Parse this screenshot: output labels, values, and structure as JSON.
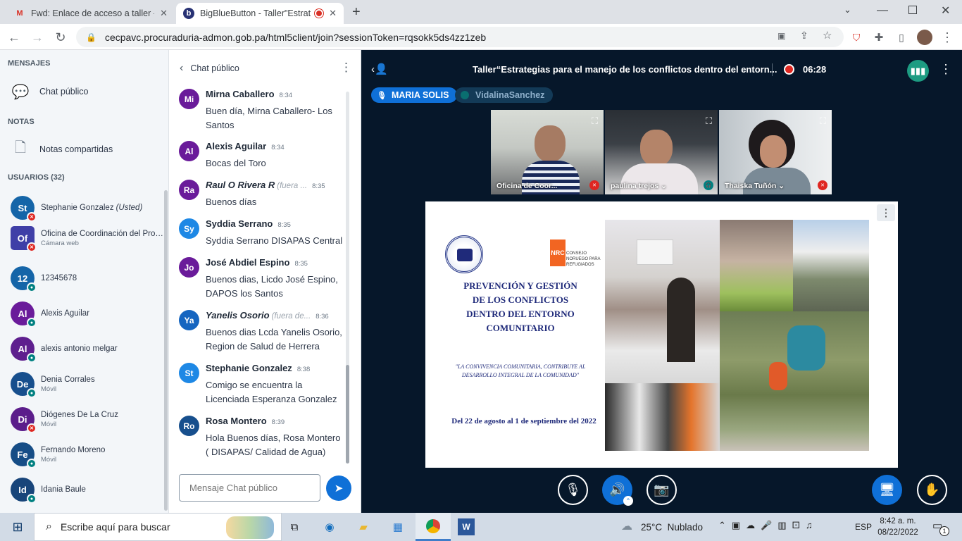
{
  "browser": {
    "tabs": [
      {
        "title": "Fwd: Enlace de acceso a taller - t",
        "active": false
      },
      {
        "title": "BigBlueButton - Taller\"Estrate",
        "active": true
      }
    ],
    "new_tab": "+",
    "url": "cecpavc.procuraduria-admon.gob.pa/html5client/join?sessionToken=rqsokk5ds4zz1zeb"
  },
  "sidebar": {
    "messages_title": "MENSAJES",
    "public_chat_label": "Chat público",
    "notes_title": "NOTAS",
    "shared_notes_label": "Notas compartidas",
    "users_title": "USUARIOS (32)",
    "users": [
      {
        "initials": "St",
        "name": "Stephanie Gonzalez",
        "you": "(Usted)",
        "sub": "",
        "color": "#1565a8",
        "badge": "red",
        "square": false
      },
      {
        "initials": "Of",
        "name": "Oficina de Coordinación del Progr...",
        "you": "",
        "sub": "Cámara web",
        "color": "#3f3fa7",
        "badge": "red",
        "square": true
      },
      {
        "initials": "12",
        "name": "12345678",
        "you": "",
        "sub": "",
        "color": "#1565a8",
        "badge": "teal",
        "square": false
      },
      {
        "initials": "Al",
        "name": "Alexis Aguilar",
        "you": "",
        "sub": "",
        "color": "#6a1b9a",
        "badge": "teal",
        "square": false
      },
      {
        "initials": "Al",
        "name": "alexis antonio melgar",
        "you": "",
        "sub": "",
        "color": "#5e1f8e",
        "badge": "teal",
        "square": false
      },
      {
        "initials": "De",
        "name": "Denia Corrales",
        "you": "",
        "sub": "Móvil",
        "color": "#174f8d",
        "badge": "teal",
        "square": false
      },
      {
        "initials": "Di",
        "name": "Diógenes De La Cruz",
        "you": "",
        "sub": "Móvil",
        "color": "#5b1d8b",
        "badge": "red",
        "square": false
      },
      {
        "initials": "Fe",
        "name": "Fernando Moreno",
        "you": "",
        "sub": "Móvil",
        "color": "#164d86",
        "badge": "teal",
        "square": false
      },
      {
        "initials": "Id",
        "name": "Idania Baule",
        "you": "",
        "sub": "",
        "color": "#18457a",
        "badge": "teal",
        "square": false
      }
    ]
  },
  "chat": {
    "title": "Chat público",
    "input_placeholder": "Mensaje Chat público",
    "messages": [
      {
        "initials": "Mi",
        "name": "Mirna Caballero",
        "note": "",
        "time": "8:34",
        "text": "Buen día, Mirna Caballero- Los Santos",
        "color": "#6a1b9a",
        "italic": false
      },
      {
        "initials": "Al",
        "name": "Alexis Aguilar",
        "note": "",
        "time": "8:34",
        "text": "Bocas del Toro",
        "color": "#6a1b9a",
        "italic": false
      },
      {
        "initials": "Ra",
        "name": "Raul O Rivera R",
        "note": "(fuera ...",
        "time": "8:35",
        "text": "Buenos días",
        "color": "#6a1b9a",
        "italic": true
      },
      {
        "initials": "Sy",
        "name": "Syddia Serrano",
        "note": "",
        "time": "8:35",
        "text": "Syddia Serrano DISAPAS Central",
        "color": "#1e88e5",
        "italic": false
      },
      {
        "initials": "Jo",
        "name": "José Abdiel Espino",
        "note": "",
        "time": "8:35",
        "text": "Buenos dias, Licdo José Espino, DAPOS los Santos",
        "color": "#6a1b9a",
        "italic": false
      },
      {
        "initials": "Ya",
        "name": "Yanelis Osorio",
        "note": "(fuera de...",
        "time": "8:36",
        "text": "Buenos dias Lcda Yanelis Osorio, Region de Salud de Herrera",
        "color": "#1565c0",
        "italic": true
      },
      {
        "initials": "St",
        "name": "Stephanie Gonzalez",
        "note": "",
        "time": "8:38",
        "text": "Comigo se encuentra la Licenciada Esperanza Gonzalez",
        "color": "#1e88e5",
        "italic": false
      },
      {
        "initials": "Ro",
        "name": "Rosa Montero",
        "note": "",
        "time": "8:39",
        "text": "Hola Buenos días, Rosa Montero ( DISAPAS/ Calidad de Agua)",
        "color": "#174f8d",
        "italic": false
      }
    ]
  },
  "meeting": {
    "title": "Taller“Estrategias para el manejo de los conflictos dentro del entorn...",
    "rec_time": "06:28",
    "talkers": [
      "MARIA SOLIS",
      "VidalinaSanchez"
    ],
    "videos": [
      {
        "label": "Oficina de Coor...",
        "badge": "red"
      },
      {
        "label": "paulina trejos",
        "badge": "teal"
      },
      {
        "label": "Thaiska Tuñón",
        "badge": "red"
      }
    ]
  },
  "slide": {
    "nrc_logo": "NRC",
    "nrc_text": "CONSEJO NORUEGO PARA REFUGIADOS",
    "heading": [
      "PREVENCIÓN Y GESTIÓN",
      "DE LOS CONFLICTOS",
      "DENTRO DEL ENTORNO",
      "COMUNITARIO"
    ],
    "quote": [
      "\"LA CONVIVENCIA COMUNITARIA, CONTRIBUYE AL",
      "DESARROLLO INTEGRAL DE LA COMUNIDAD\""
    ],
    "dates": "Del 22 de agosto al 1 de septiembre del 2022"
  },
  "taskbar": {
    "search_placeholder": "Escribe aquí para buscar",
    "weather": "25°C  Nublado",
    "lang": "ESP",
    "time": "8:42 a. m.",
    "date": "08/22/2022",
    "notifications": "1"
  }
}
